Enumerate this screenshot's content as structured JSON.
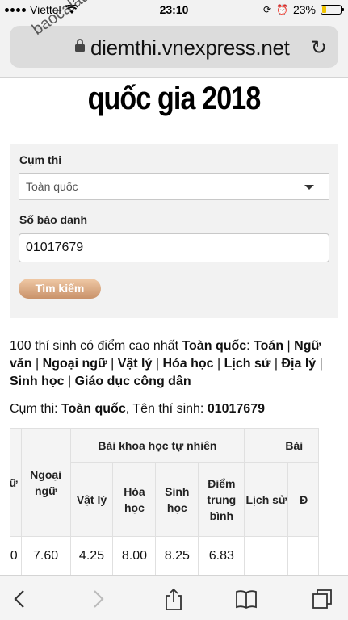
{
  "status": {
    "carrier": "Viettel",
    "time": "23:10",
    "battery": "23%"
  },
  "browser": {
    "url": "diemthi.vnexpress.net",
    "watermark": "baocalau.net"
  },
  "headline": "quốc gia 2018",
  "form": {
    "cluster_label": "Cụm thi",
    "cluster_value": "Toàn quốc",
    "sbd_label": "Số báo danh",
    "sbd_value": "01017679",
    "search_button": "Tìm kiếm"
  },
  "top_text": {
    "prefix": "100 thí sinh có điểm cao nhất ",
    "scope": "Toàn quốc",
    "colon": ": ",
    "links": [
      "Toán",
      "Ngữ văn",
      "Ngoại ngữ",
      "Vật lý",
      "Hóa học",
      "Lịch sử",
      "Địa lý",
      "Sinh học",
      "Giáo dục công dân"
    ]
  },
  "summary": {
    "cluster_label": "Cụm thi: ",
    "cluster": "Toàn quốc",
    "name_label": ", Tên thí sinh: ",
    "name": "01017679"
  },
  "table": {
    "first_col_partial": "ữ",
    "first_val_partial": "0",
    "foreign_lang": "Ngoại ngữ",
    "group_natural": "Bài khoa học tự nhiên",
    "group_social_partial": "Bài",
    "natural_cols": [
      "Vật lý",
      "Hóa học",
      "Sinh học",
      "Điểm trung bình"
    ],
    "social_cols_partial": [
      "Lịch sử",
      "Đ"
    ],
    "values": [
      "7.60",
      "4.25",
      "8.00",
      "8.25",
      "6.83",
      "",
      ""
    ]
  }
}
